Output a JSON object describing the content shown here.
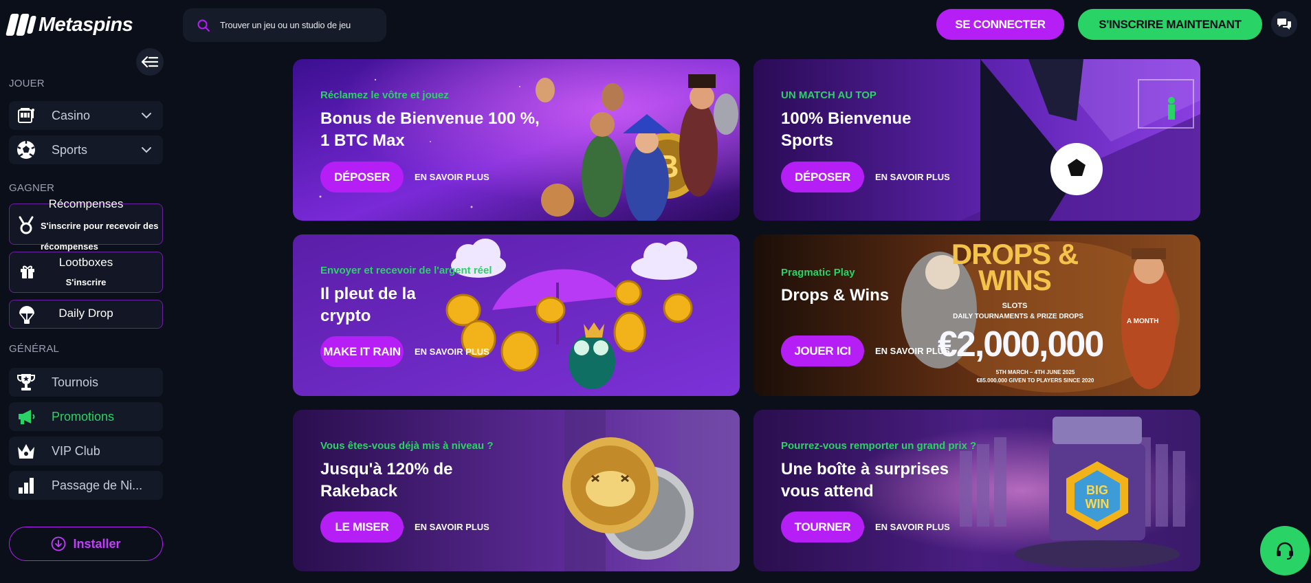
{
  "brand": {
    "name": "Metaspins"
  },
  "header": {
    "search_placeholder": "Trouver un jeu ou un studio de jeu",
    "login_label": "SE CONNECTER",
    "register_label": "S'INSCRIRE MAINTENANT"
  },
  "sidebar": {
    "section_play": "JOUER",
    "casino": "Casino",
    "sports": "Sports",
    "section_earn": "GAGNER",
    "rewards_title": "Récompenses",
    "rewards_sub": "S'inscrire pour recevoir des récompenses",
    "lootboxes_title": "Lootboxes",
    "lootboxes_sub": "S'inscrire",
    "daily_drop": "Daily Drop",
    "section_general": "GÉNÉRAL",
    "tournaments": "Tournois",
    "promotions": "Promotions",
    "vip": "VIP Club",
    "levelup": "Passage de Ni...",
    "install": "Installer"
  },
  "banners": [
    {
      "kicker": "Réclamez le vôtre et jouez",
      "heading": "Bonus de Bienvenue 100 %, 1 BTC Max",
      "cta": "DÉPOSER",
      "more": "EN SAVOIR PLUS"
    },
    {
      "kicker": "UN MATCH AU TOP",
      "heading": "100% Bienvenue Sports",
      "cta": "DÉPOSER",
      "more": "EN SAVOIR PLUS"
    },
    {
      "kicker": "Envoyer et recevoir de l'argent réel",
      "heading": "Il pleut de la crypto",
      "cta": "MAKE IT RAIN",
      "more": "EN SAVOIR PLUS"
    },
    {
      "kicker": "Pragmatic Play",
      "heading": "Drops & Wins",
      "cta": "JOUER ICI",
      "more": "EN SAVOIR PLUS",
      "art_text": {
        "logo": "DROPS & WINS",
        "logo_sub": "SLOTS",
        "tagline": "DAILY TOURNAMENTS & PRIZE DROPS",
        "prize": "€2,000,000",
        "month": "A MONTH",
        "dates": "5TH MARCH – 4TH JUNE 2025",
        "total": "€85.000.000 GIVEN TO PLAYERS SINCE 2020"
      }
    },
    {
      "kicker": "Vous êtes-vous déjà mis à niveau ?",
      "heading": "Jusqu'à 120% de Rakeback",
      "cta": "LE MISER",
      "more": "EN SAVOIR PLUS"
    },
    {
      "kicker": "Pourrez-vous remporter un grand prix ?",
      "heading": "Une boîte à surprises vous attend",
      "cta": "TOURNER",
      "more": "EN SAVOIR PLUS",
      "art_text": {
        "badge": "BIG WIN"
      }
    }
  ],
  "colors": {
    "accent": "#b51ef5",
    "green": "#2ad366",
    "bg": "#0b0f1a"
  }
}
